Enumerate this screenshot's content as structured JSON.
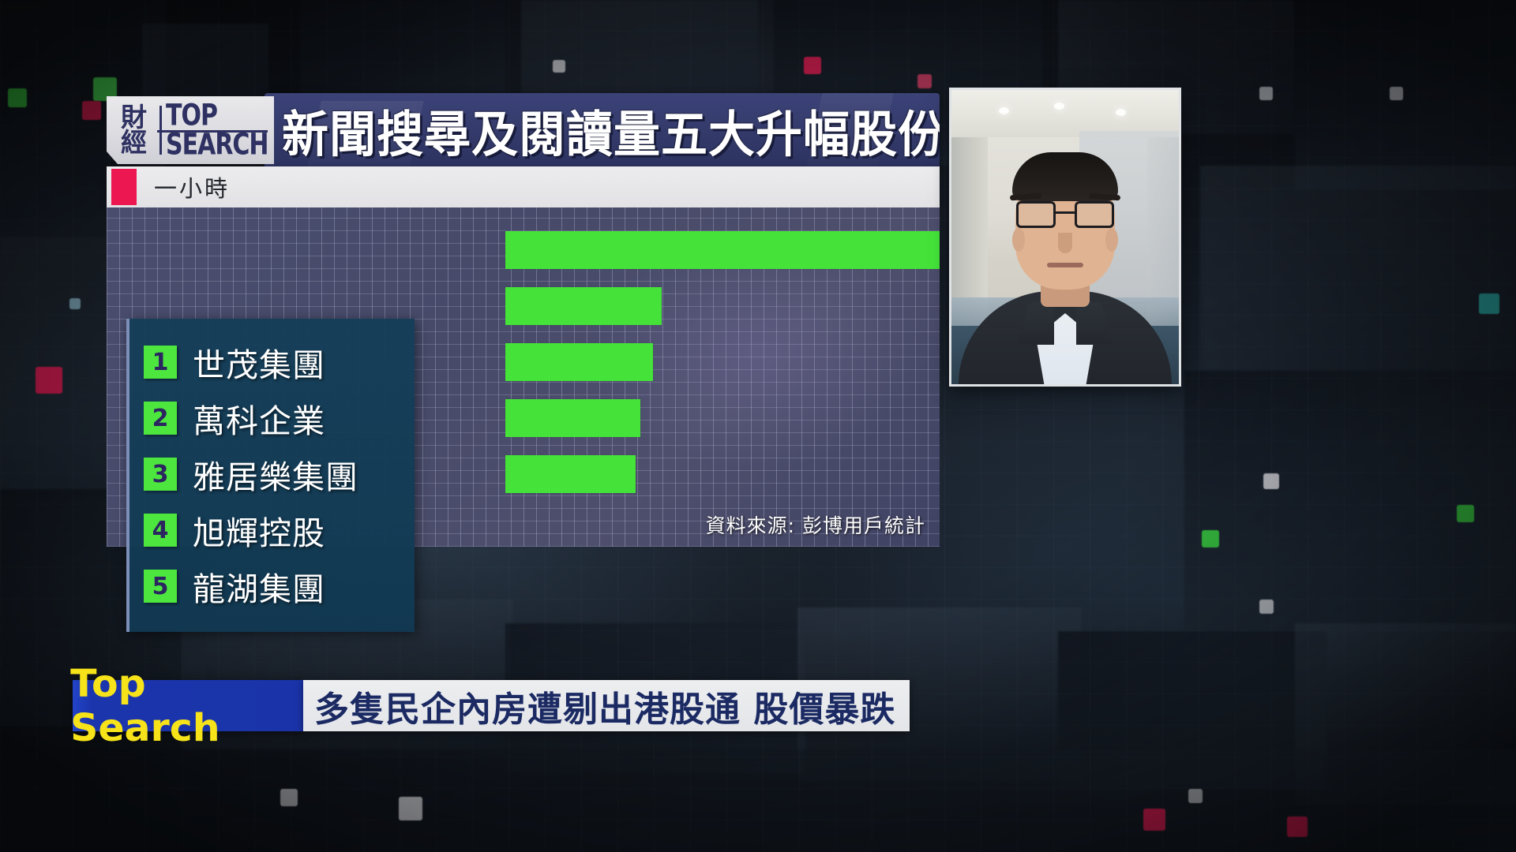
{
  "brand": {
    "logo_cn_top": "財",
    "logo_cn_bottom": "經",
    "logo_en_top": "TOP",
    "logo_en_bottom": "SEARCH"
  },
  "header": {
    "title": "新聞搜尋及閱讀量五大升幅股份"
  },
  "legend": {
    "marker_color": "#ec1651",
    "label": "一小時"
  },
  "chart_data": {
    "type": "bar",
    "orientation": "horizontal",
    "title": "新聞搜尋及閱讀量五大升幅股份",
    "series_name": "一小時",
    "bar_color": "#45e33a",
    "grid": true,
    "legend_position": "top-left",
    "xlabel": "",
    "ylabel": "",
    "xlim": [
      0,
      100
    ],
    "categories": [
      "世茂集團",
      "萬科企業",
      "雅居樂集團",
      "旭輝控股",
      "龍湖集團"
    ],
    "values": [
      100,
      36,
      34,
      31,
      30
    ],
    "ranks": [
      "1",
      "2",
      "3",
      "4",
      "5"
    ],
    "tick_labels": []
  },
  "list": {
    "rows": [
      {
        "rank": "1",
        "name": "世茂集團"
      },
      {
        "rank": "2",
        "name": "萬科企業"
      },
      {
        "rank": "3",
        "name": "雅居樂集團"
      },
      {
        "rank": "4",
        "name": "旭輝控股"
      },
      {
        "rank": "5",
        "name": "龍湖集團"
      }
    ]
  },
  "source": {
    "text": "資料來源: 彭博用戶統計"
  },
  "ticker": {
    "brand": "Top Search",
    "headline": "多隻民企內房遭剔出港股通 股價暴跌",
    "brand_bg": "#1a33a8",
    "brand_fg": "#f7e319"
  }
}
